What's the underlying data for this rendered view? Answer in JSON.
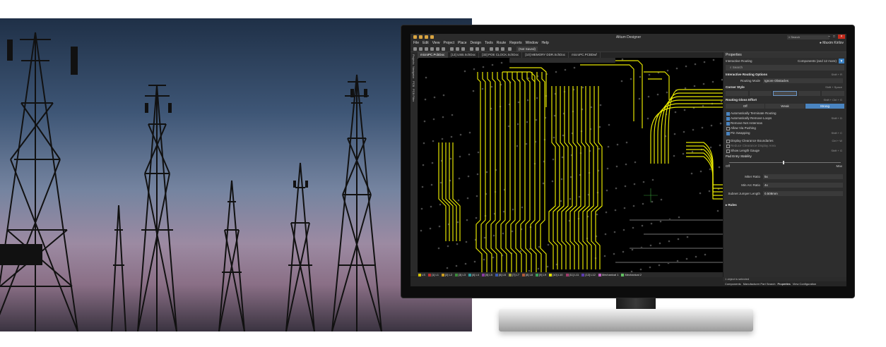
{
  "app": {
    "title": "Altium Designer",
    "search_placeholder": "Search",
    "user": "Maxim Kirilov",
    "not_saved": "(Not Saved)"
  },
  "menu": [
    "File",
    "Edit",
    "View",
    "Project",
    "Place",
    "Design",
    "Tools",
    "Route",
    "Reports",
    "Window",
    "Help"
  ],
  "doc_tabs": [
    {
      "label": "microPC.PcbDoc",
      "active": true
    },
    {
      "label": "[13] USB.SchDoc",
      "active": false
    },
    {
      "label": "[33] POE CLOCK.SchDoc",
      "active": false
    },
    {
      "label": "[10] MEMORY DDR.SchDoc",
      "active": false
    },
    {
      "label": "microPC.PCBDwf",
      "active": false
    }
  ],
  "left_rail": [
    "Projects",
    "Navigator",
    "PCB",
    "PCB Filter"
  ],
  "properties": {
    "panel_title": "Properties",
    "context": "Interactive Routing",
    "filter_text": "Components (and 12 more)",
    "search_placeholder": "Search",
    "section_routing": "Interactive Routing Options",
    "section_routing_shortcut": "Shift + R",
    "routing_mode_label": "Routing Mode",
    "routing_mode_value": "Ignore Obstacles",
    "corner_style_label": "Corner Style",
    "corner_style_shortcut": "Shift + Space",
    "gloss_label": "Routing Gloss Effort",
    "gloss_shortcut": "Shift + Ctrl + G",
    "gloss_options": [
      "Off",
      "Weak",
      "Strong"
    ],
    "gloss_selected": "Strong",
    "options": [
      {
        "label": "Automatically Terminate Routing",
        "checked": true,
        "dim": false,
        "shortcut": ""
      },
      {
        "label": "Automatically Remove Loops",
        "checked": true,
        "dim": false,
        "shortcut": "Shift + D"
      },
      {
        "label": "Remove Net Antennas",
        "checked": true,
        "dim": false,
        "shortcut": ""
      },
      {
        "label": "Allow Via Pushing",
        "checked": false,
        "dim": false,
        "shortcut": ""
      },
      {
        "label": "Pin Swapping",
        "checked": true,
        "dim": false,
        "shortcut": "Shift + C"
      },
      {
        "label": "Display Clearance Boundaries",
        "checked": false,
        "dim": false,
        "shortcut": "Ctrl + W"
      },
      {
        "label": "Reduce Clearance Display Area",
        "checked": false,
        "dim": true,
        "shortcut": ""
      },
      {
        "label": "Show Length Gauge",
        "checked": false,
        "dim": false,
        "shortcut": "Shift + G"
      }
    ],
    "pad_entry_label": "Pad Entry Stability",
    "slider_min": "Off",
    "slider_max": "Max",
    "miter_label": "Miter Ratio",
    "miter_value": "5x",
    "min_arc_label": "Min Arc Ratio",
    "min_arc_value": "4x",
    "jumper_label": "Subnet Jumper Length",
    "jumper_value": "0.508mm",
    "rules_label": "Rules",
    "status": "1 object is selected",
    "bottom_tabs": [
      "Components",
      "Manufacturer Part Search",
      "Properties",
      "View Configuration"
    ],
    "active_bottom_tab": "Properties"
  },
  "layers": [
    {
      "label": "LS",
      "color": "#d4c200"
    },
    {
      "label": "[1] L1",
      "color": "#c03030"
    },
    {
      "label": "[2] L2",
      "color": "#c89a20"
    },
    {
      "label": "[3] L3",
      "color": "#3a8a3a"
    },
    {
      "label": "[4] L4",
      "color": "#2f9c9c"
    },
    {
      "label": "[5] L5",
      "color": "#8a3aa0"
    },
    {
      "label": "[6] L6",
      "color": "#3a5ab0"
    },
    {
      "label": "[7] L7",
      "color": "#a0a03a"
    },
    {
      "label": "[8] L8",
      "color": "#b05a3a"
    },
    {
      "label": "[9] L9",
      "color": "#3aa05a"
    },
    {
      "label": "[10] L10",
      "color": "#e0e000"
    },
    {
      "label": "[11] L11",
      "color": "#a03a6a"
    },
    {
      "label": "[12] L12",
      "color": "#5a3ab0"
    },
    {
      "label": "Mechanical 1",
      "color": "#c060c0"
    },
    {
      "label": "Mechanical 2",
      "color": "#60c060"
    }
  ],
  "colors": {
    "trace": "#e6e600",
    "board": "#000000",
    "panel": "#2d2d2d",
    "accent": "#4a84c0"
  }
}
